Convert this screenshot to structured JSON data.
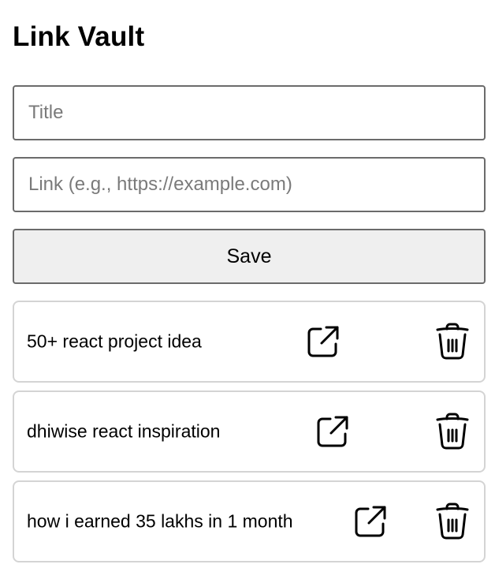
{
  "app": {
    "title": "Link Vault"
  },
  "form": {
    "title_placeholder": "Title",
    "link_placeholder": "Link (e.g., https://example.com)",
    "save_label": "Save"
  },
  "links": [
    {
      "title": "50+ react project idea",
      "open_icon": "external-link-icon",
      "delete_icon": "trash-icon"
    },
    {
      "title": "dhiwise react inspiration",
      "open_icon": "external-link-icon",
      "delete_icon": "trash-icon"
    },
    {
      "title": "how i earned 35 lakhs in 1 month",
      "open_icon": "external-link-icon",
      "delete_icon": "trash-icon"
    }
  ]
}
